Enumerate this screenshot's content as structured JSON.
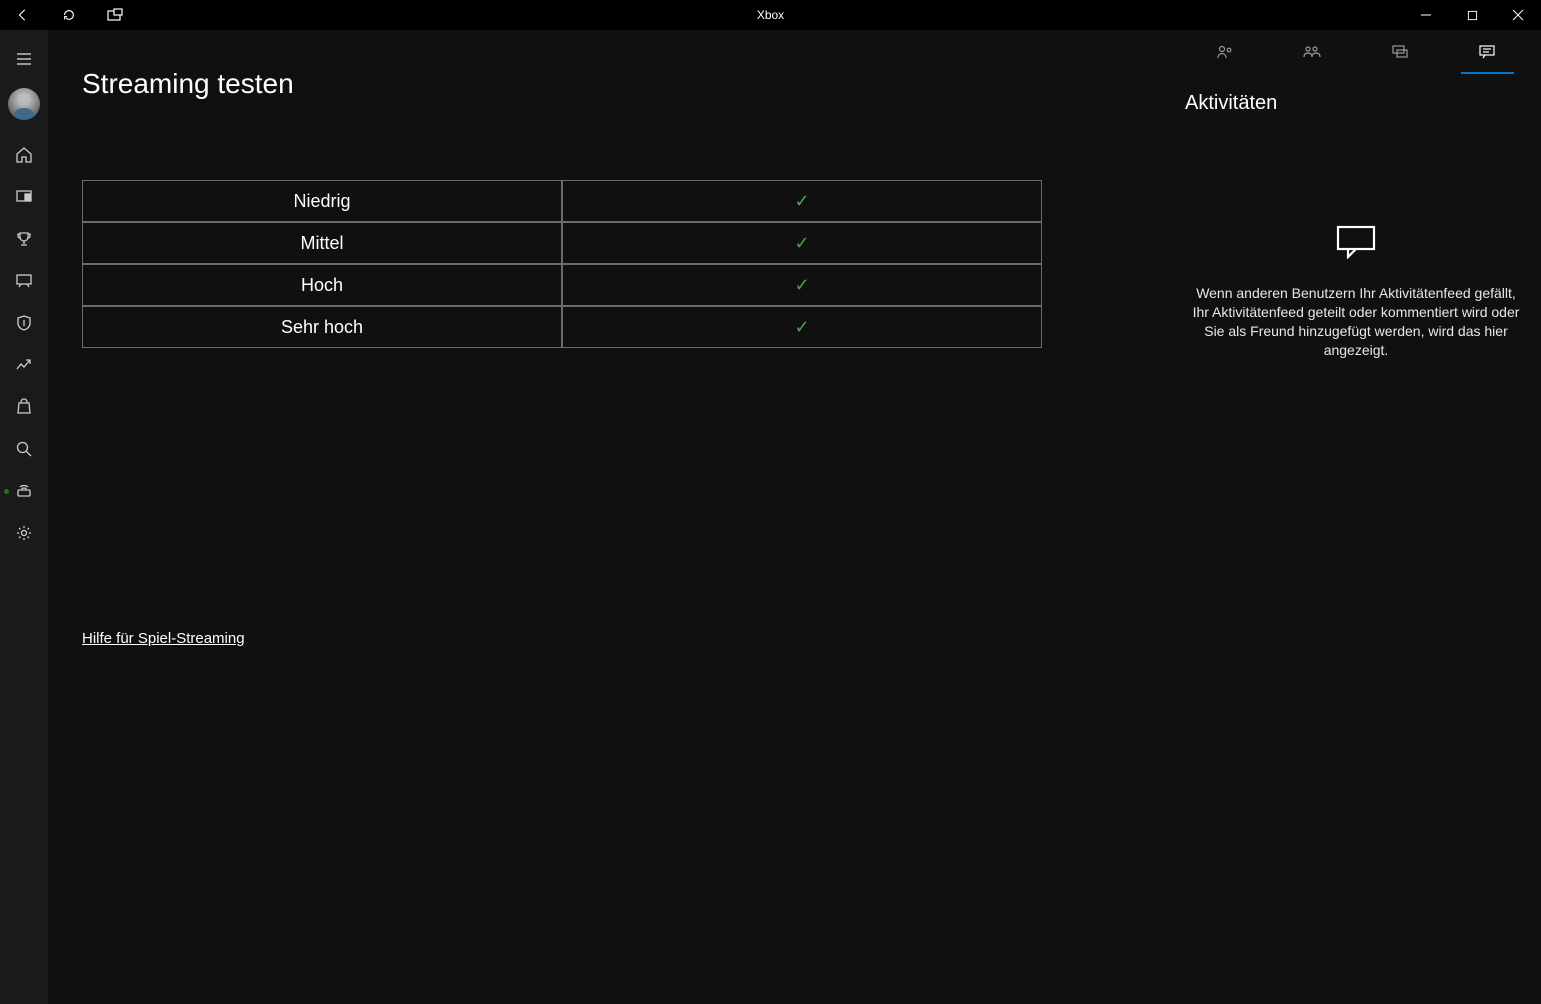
{
  "titlebar": {
    "title": "Xbox"
  },
  "page": {
    "title": "Streaming testen"
  },
  "quality_table": {
    "rows": [
      {
        "label": "Niedrig",
        "pass": true
      },
      {
        "label": "Mittel",
        "pass": true
      },
      {
        "label": "Hoch",
        "pass": true
      },
      {
        "label": "Sehr hoch",
        "pass": true
      }
    ]
  },
  "help_link": {
    "label": "Hilfe für Spiel-Streaming"
  },
  "rightpanel": {
    "heading": "Aktivitäten",
    "empty_message": "Wenn anderen Benutzern Ihr Aktivitätenfeed gefällt, Ihr Aktivitätenfeed geteilt oder kommentiert wird oder Sie als Freund hinzugefügt werden, wird das hier angezeigt."
  },
  "leftnav": {
    "items": [
      {
        "name": "hamburger-icon"
      },
      {
        "name": "avatar"
      },
      {
        "name": "home-icon"
      },
      {
        "name": "display-icon"
      },
      {
        "name": "trophy-icon"
      },
      {
        "name": "chat-device-icon"
      },
      {
        "name": "shield-icon"
      },
      {
        "name": "trend-icon"
      },
      {
        "name": "store-icon"
      },
      {
        "name": "search-icon"
      },
      {
        "name": "streaming-icon",
        "active": true
      },
      {
        "name": "settings-icon"
      }
    ]
  },
  "right_tabs": {
    "items": [
      {
        "name": "friends-icon",
        "active": false
      },
      {
        "name": "party-icon",
        "active": false
      },
      {
        "name": "messages-icon",
        "active": false
      },
      {
        "name": "activity-icon",
        "active": true
      }
    ]
  }
}
